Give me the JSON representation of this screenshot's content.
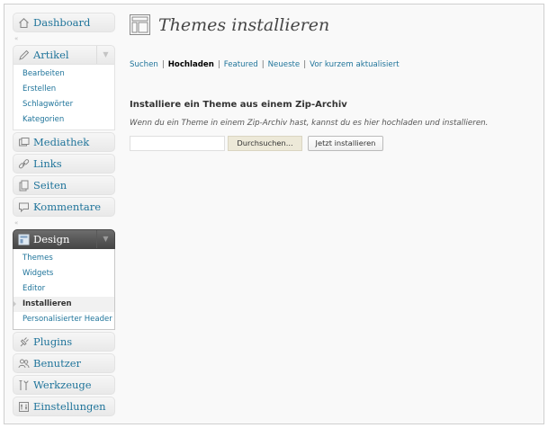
{
  "sidebar": {
    "dashboard": "Dashboard",
    "artikel": {
      "label": "Artikel",
      "items": [
        "Bearbeiten",
        "Erstellen",
        "Schlagwörter",
        "Kategorien"
      ]
    },
    "mediathek": "Mediathek",
    "links": "Links",
    "seiten": "Seiten",
    "kommentare": "Kommentare",
    "design": {
      "label": "Design",
      "items": [
        "Themes",
        "Widgets",
        "Editor",
        "Installieren",
        "Personalisierter Header"
      ]
    },
    "plugins": "Plugins",
    "benutzer": "Benutzer",
    "werkzeuge": "Werkzeuge",
    "einstellungen": "Einstellungen"
  },
  "page": {
    "title": "Themes installieren",
    "tabs": [
      "Suchen",
      "Hochladen",
      "Featured",
      "Neueste",
      "Vor kurzem aktualisiert"
    ],
    "current_tab": "Hochladen",
    "section_heading": "Installiere ein Theme aus einem Zip-Archiv",
    "description": "Wenn du ein Theme in einem Zip-Archiv hast, kannst du es hier hochladen und installieren.",
    "file_input_value": "",
    "browse_button": "Durchsuchen...",
    "install_button": "Jetzt installieren"
  },
  "colors": {
    "link": "#21759b",
    "menu_open_dark": "#464646",
    "browse_button_bg": "#ede9d8"
  }
}
